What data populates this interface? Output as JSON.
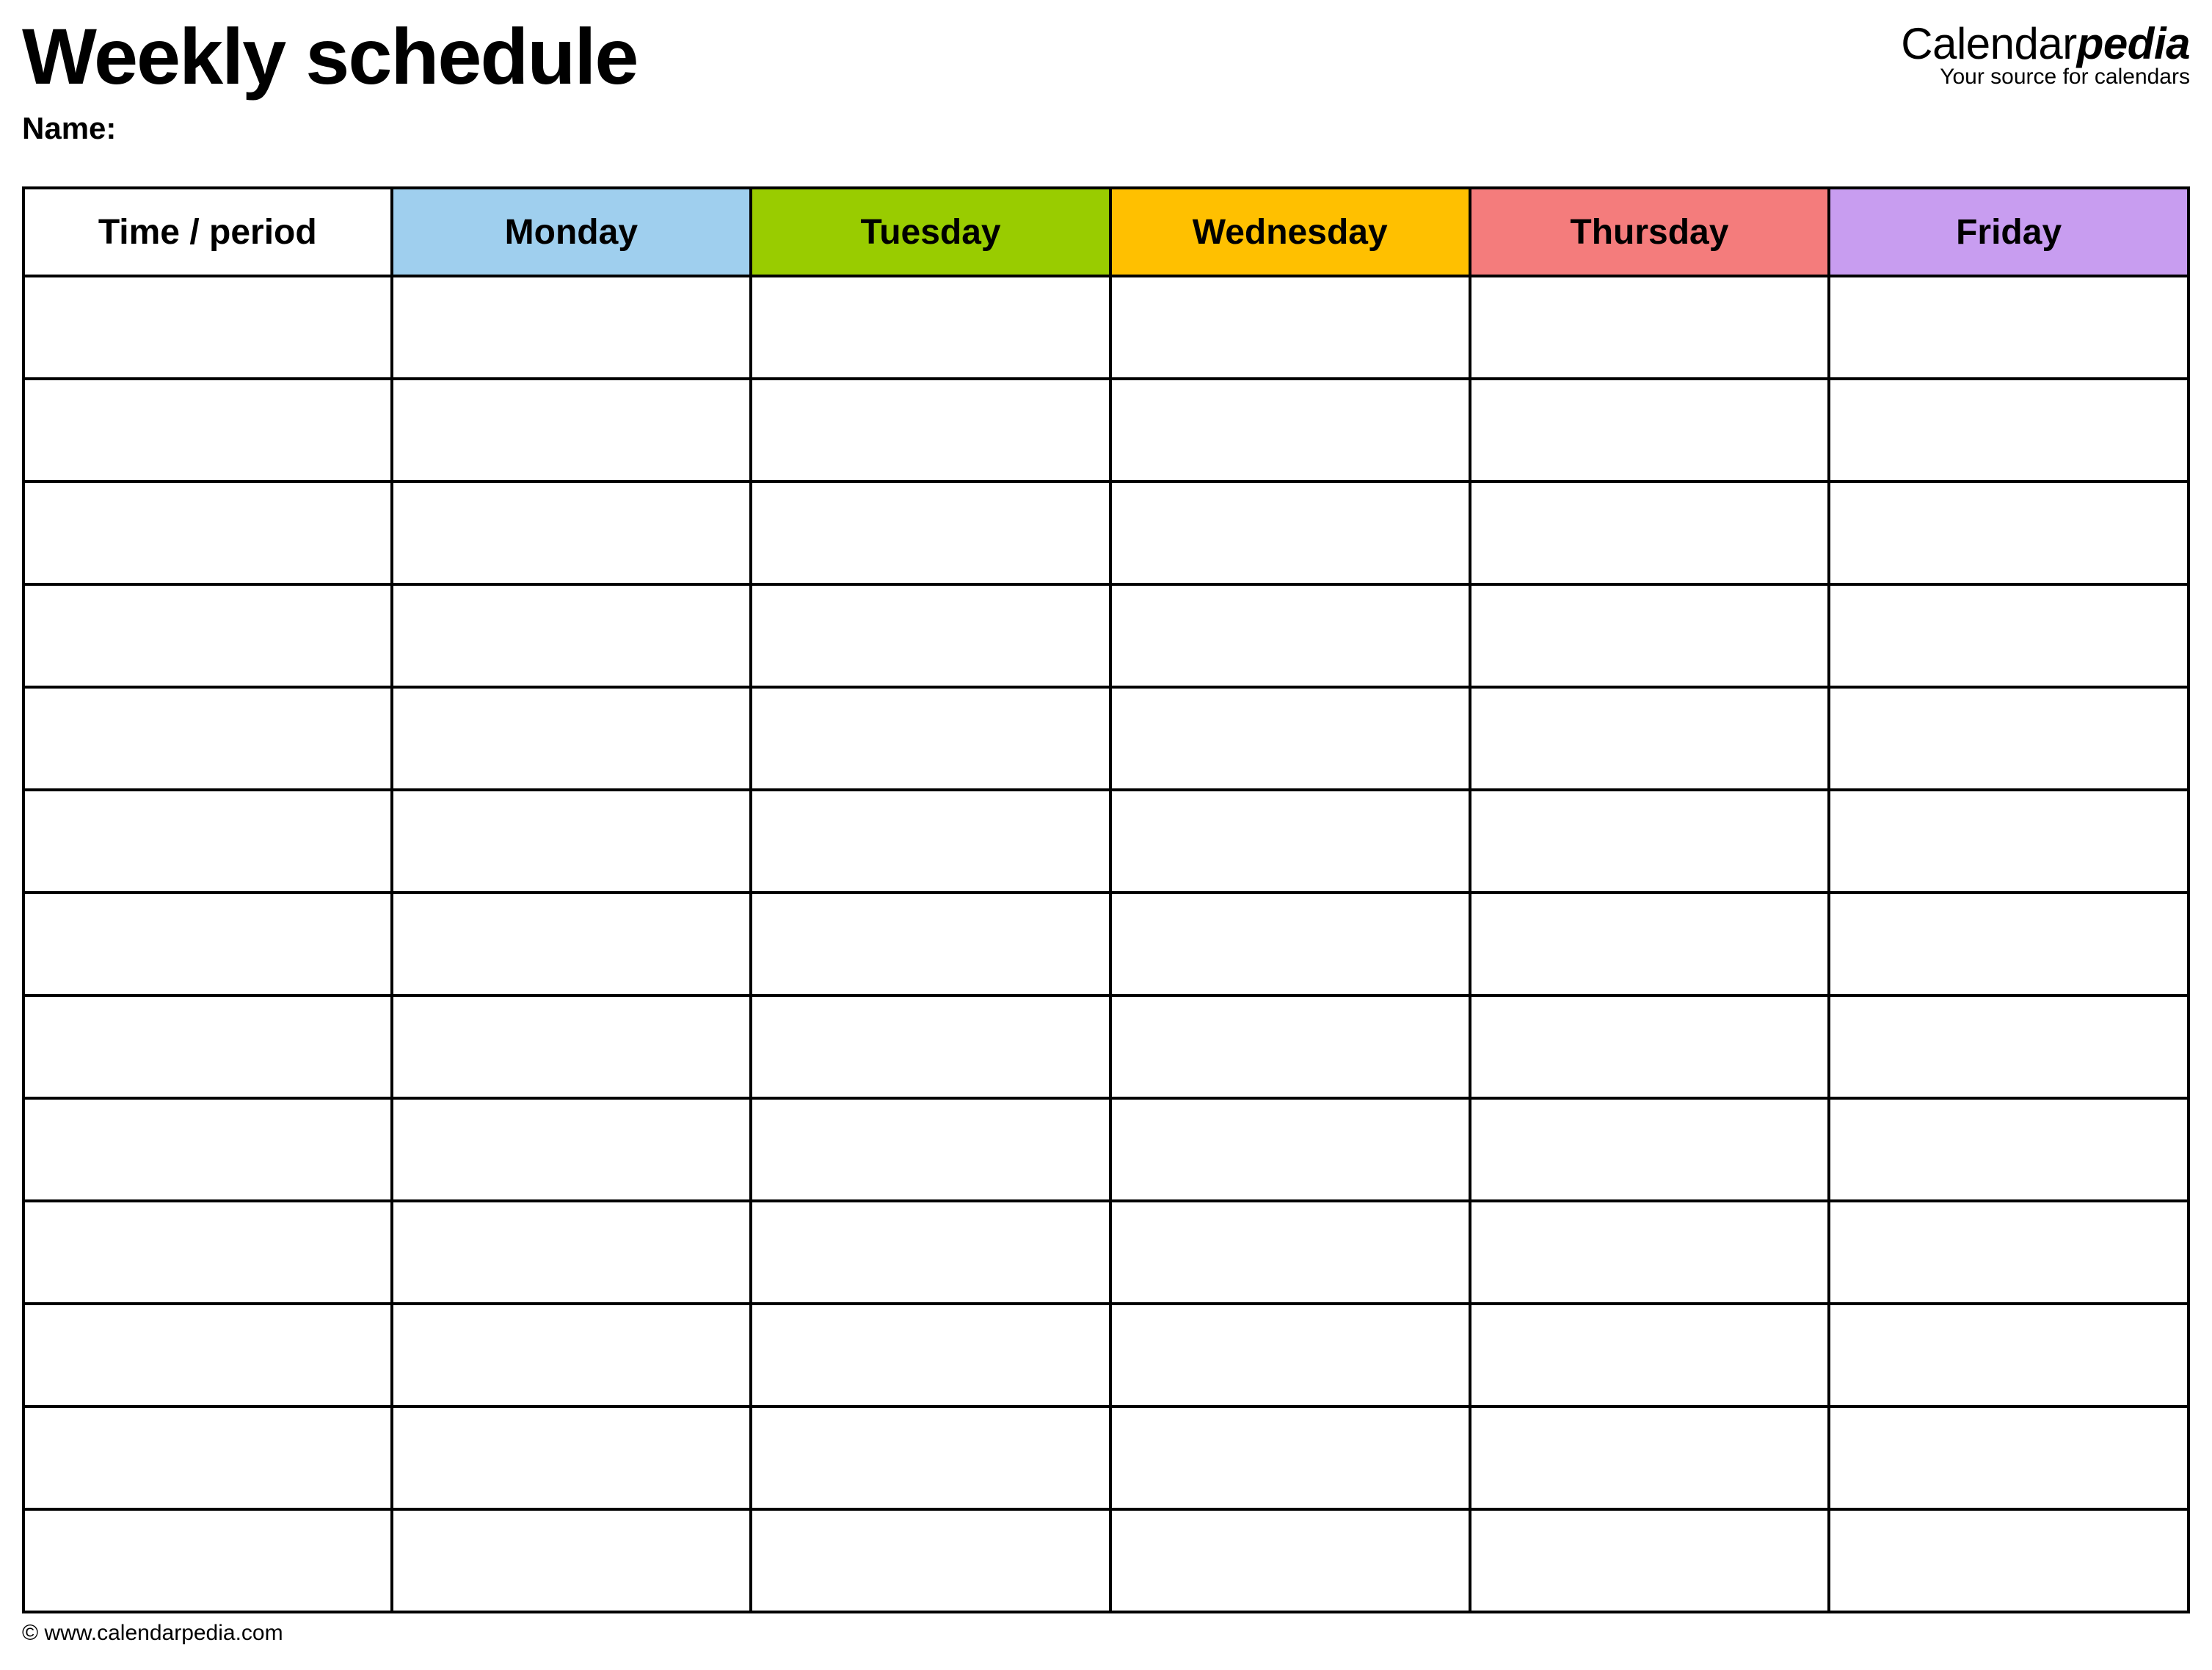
{
  "header": {
    "title": "Weekly schedule",
    "name_label": "Name:"
  },
  "brand": {
    "part1": "Calendar",
    "part2": "pedia",
    "tagline": "Your source for calendars"
  },
  "table": {
    "headers": {
      "time": "Time / period",
      "monday": "Monday",
      "tuesday": "Tuesday",
      "wednesday": "Wednesday",
      "thursday": "Thursday",
      "friday": "Friday"
    },
    "colors": {
      "monday": "#9FCFEE",
      "tuesday": "#99CC00",
      "wednesday": "#FFC000",
      "thursday": "#F47C7C",
      "friday": "#C89DF0"
    },
    "row_count": 13
  },
  "footer": {
    "copyright": "© www.calendarpedia.com"
  }
}
